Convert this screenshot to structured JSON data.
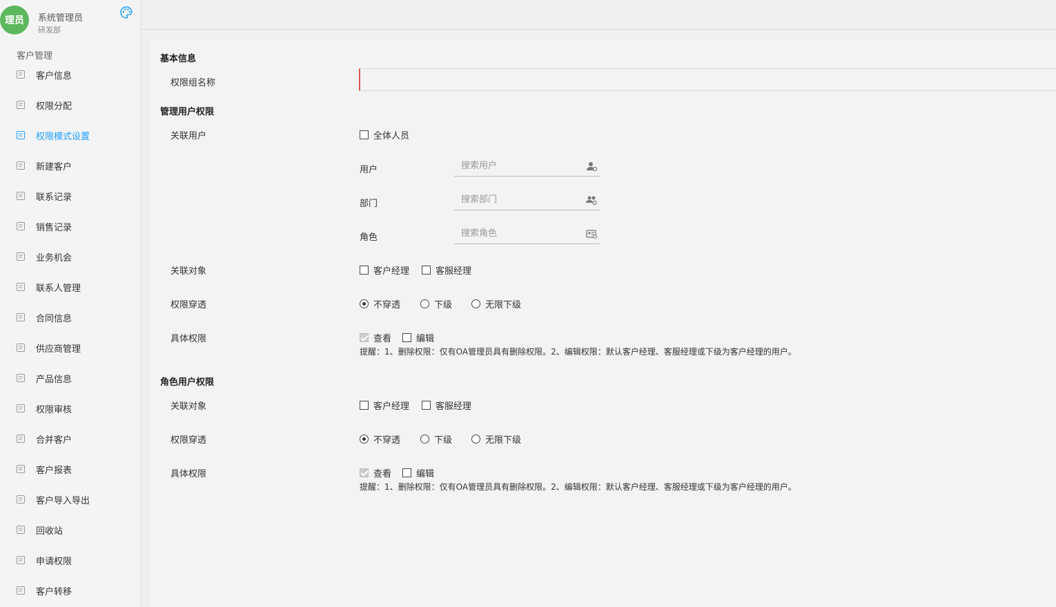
{
  "user": {
    "avatar": "理员",
    "name": "系统管理员",
    "dept": "研发部"
  },
  "sidebar": {
    "section": "客户管理",
    "items": [
      {
        "label": "客户信息",
        "icon": "user-icon"
      },
      {
        "label": "权限分配",
        "icon": "grid-icon"
      },
      {
        "label": "权限模式设置",
        "icon": "grid-icon",
        "active": true
      },
      {
        "label": "新建客户",
        "icon": "user-add-icon"
      },
      {
        "label": "联系记录",
        "icon": "record-icon"
      },
      {
        "label": "销售记录",
        "icon": "sales-icon"
      },
      {
        "label": "业务机会",
        "icon": "briefcase-icon"
      },
      {
        "label": "联系人管理",
        "icon": "phone-icon"
      },
      {
        "label": "合同信息",
        "icon": "contract-icon"
      },
      {
        "label": "供应商管理",
        "icon": "store-icon"
      },
      {
        "label": "产品信息",
        "icon": "document-icon"
      },
      {
        "label": "权限审核",
        "icon": "shield-icon"
      },
      {
        "label": "合并客户",
        "icon": "merge-icon"
      },
      {
        "label": "客户报表",
        "icon": "report-icon"
      },
      {
        "label": "客户导入导出",
        "icon": "import-export-icon"
      },
      {
        "label": "回收站",
        "icon": "trash-icon"
      },
      {
        "label": "申请权限",
        "icon": "apply-icon"
      },
      {
        "label": "客户转移",
        "icon": "transfer-icon"
      }
    ]
  },
  "form": {
    "basic_title": "基本信息",
    "group_name_label": "权限组名称",
    "group_name_value": "",
    "manage_title": "管理用户权限",
    "related_users_label": "关联用户",
    "all_members": "全体人员",
    "user_label": "用户",
    "user_placeholder": "搜索用户",
    "dept_label": "部门",
    "dept_placeholder": "搜索部门",
    "role_label": "角色",
    "role_placeholder": "搜索角色",
    "related_object_label": "关联对象",
    "customer_manager": "客户经理",
    "service_manager": "客服经理",
    "penetration_label": "权限穿透",
    "no_penetrate": "不穿透",
    "subordinate": "下级",
    "unlimited_sub": "无限下级",
    "specific_label": "具体权限",
    "view": "查看",
    "edit": "编辑",
    "tip": "提醒：1、删除权限：仅有OA管理员具有删除权限。2、编辑权限：默认客户经理、客服经理或下级为客户经理的用户。",
    "role_title": "角色用户权限"
  },
  "colors": {
    "accent": "#1e9fff",
    "avatar": "#5cb85c",
    "required": "#e05454"
  }
}
